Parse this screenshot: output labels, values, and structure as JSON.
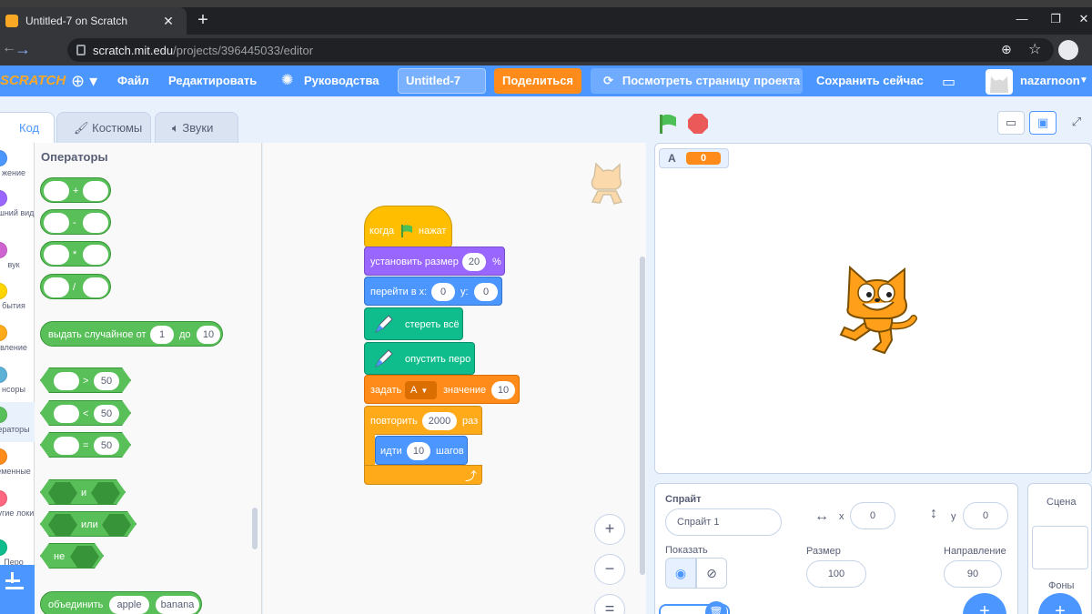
{
  "browser": {
    "tab_title": "Untitled-7 on Scratch",
    "tab_close": "✕",
    "new_tab": "+",
    "url_host": "scratch.mit.edu",
    "url_path": "/projects/396445033/editor",
    "minimize": "—",
    "restore": "❐",
    "close": "✕"
  },
  "menubar": {
    "logo": "SCRATCH",
    "file": "Файл",
    "edit": "Редактировать",
    "tutorials": "Руководства",
    "project_title": "Untitled-7",
    "share": "Поделиться",
    "see_project": "Посмотреть страницу проекта",
    "save_now": "Сохранить сейчас",
    "username": "nazarnoon"
  },
  "tabs": {
    "code": "Код",
    "costumes": "Костюмы",
    "sounds": "Звуки"
  },
  "categories": [
    {
      "label": "жение",
      "color": "#4c97ff"
    },
    {
      "label": "ешний вид",
      "color": "#9966ff"
    },
    {
      "label": "вук",
      "color": "#cf63cf"
    },
    {
      "label": "бытия",
      "color": "#ffd500"
    },
    {
      "label": "вление",
      "color": "#ffab19"
    },
    {
      "label": "нсоры",
      "color": "#5cb1d6"
    },
    {
      "label": "ераторы",
      "color": "#59c059"
    },
    {
      "label": "еменные",
      "color": "#ff8c1a"
    },
    {
      "label": "ругие локи",
      "color": "#ff6680"
    },
    {
      "label": "Перо",
      "color": "#0fbd8c"
    }
  ],
  "palette": {
    "title": "Операторы",
    "add": "+",
    "sub": "-",
    "mul": "*",
    "div": "/",
    "random_label": "выдать случайное от",
    "random_from": "1",
    "random_to_label": "до",
    "random_to": "10",
    "gt": ">",
    "lt": "<",
    "eq": "=",
    "cmp_value": "50",
    "and": "и",
    "or": "или",
    "not": "не",
    "join_label": "объединить",
    "join_a": "apple",
    "join_b": "banana"
  },
  "script": {
    "hat_label": "когда",
    "hat_label2": "нажат",
    "set_size_label": "установить размер",
    "set_size_value": "20",
    "set_size_unit": "%",
    "goto_label": "перейти в x:",
    "goto_x": "0",
    "goto_y_label": "y:",
    "goto_y": "0",
    "clear_label": "стереть всё",
    "pendown_label": "опустить перо",
    "setvar_label": "задать",
    "setvar_var": "A",
    "setvar_value_label": "значение",
    "setvar_value": "10",
    "repeat_label": "повторить",
    "repeat_value": "2000",
    "repeat_times": "раз",
    "move_label": "идти",
    "move_value": "10",
    "move_steps": "шагов",
    "loop_arrow": "⤴"
  },
  "zoom": {
    "in": "+",
    "out": "−",
    "reset": "="
  },
  "stage": {
    "var_name": "A",
    "var_value": "0"
  },
  "sprite_info": {
    "sprite_label": "Спрайт",
    "sprite_name": "Спрайт 1",
    "x_label": "x",
    "x_value": "0",
    "y_label": "y",
    "y_value": "0",
    "show_label": "Показать",
    "size_label": "Размер",
    "size_value": "100",
    "direction_label": "Направление",
    "direction_value": "90"
  },
  "stage_pane": {
    "title": "Сцена",
    "backdrops_label": "Фоны"
  }
}
